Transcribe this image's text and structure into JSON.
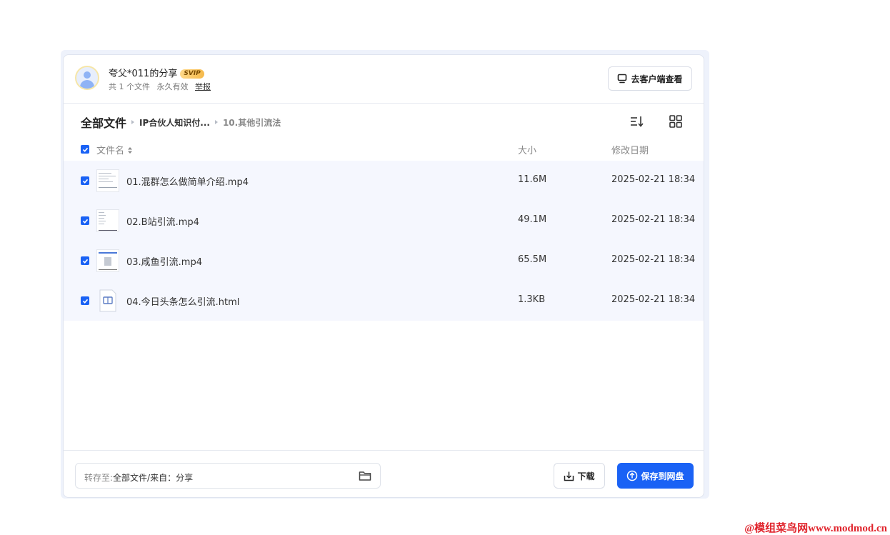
{
  "header": {
    "sharer": "夸父*011的分享",
    "badge": "SVIP",
    "file_count": "共 1 个文件",
    "validity": "永久有效",
    "report": "举报",
    "client_button": "去客户端查看"
  },
  "breadcrumb": {
    "root": "全部文件",
    "level1": "IP合伙人知识付...",
    "current": "10.其他引流法"
  },
  "table": {
    "headers": {
      "name": "文件名",
      "size": "大小",
      "date": "修改日期"
    },
    "rows": [
      {
        "name": "01.混群怎么做简单介绍.mp4",
        "size": "11.6M",
        "date": "2025-02-21 18:34",
        "type": "video",
        "checked": true
      },
      {
        "name": "02.B站引流.mp4",
        "size": "49.1M",
        "date": "2025-02-21 18:34",
        "type": "video",
        "checked": true
      },
      {
        "name": "03.咸鱼引流.mp4",
        "size": "65.5M",
        "date": "2025-02-21 18:34",
        "type": "video",
        "checked": true
      },
      {
        "name": "04.今日头条怎么引流.html",
        "size": "1.3KB",
        "date": "2025-02-21 18:34",
        "type": "html",
        "checked": true
      }
    ]
  },
  "footer": {
    "dest_label": "转存至:",
    "dest_path": "全部文件/来自：分享",
    "download": "下载",
    "save": "保存到网盘"
  },
  "watermark": "@模组菜鸟网www.modmod.cn",
  "colors": {
    "accent": "#1a62f5",
    "row_bg": "#f5f7fe",
    "watermark": "#e0242c"
  }
}
